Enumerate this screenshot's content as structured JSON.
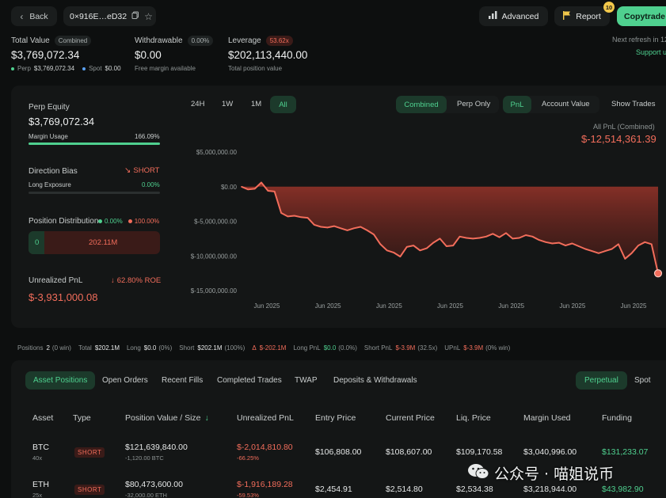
{
  "header": {
    "back_label": "Back",
    "address": "0×916E…eD32",
    "advanced_label": "Advanced",
    "report_label": "Report",
    "report_badge": "10",
    "copytrade_label": "Copytrade"
  },
  "summary": {
    "total_value_label": "Total Value",
    "total_value_tag": "Combined",
    "total_value": "$3,769,072.34",
    "perp_label": "Perp",
    "perp_value": "$3,769,072.34",
    "spot_label": "Spot",
    "spot_value": "$0.00",
    "withdrawable_label": "Withdrawable",
    "withdrawable_tag": "0.00%",
    "withdrawable_value": "$0.00",
    "withdrawable_sub": "Free margin available",
    "leverage_label": "Leverage",
    "leverage_tag": "53.62x",
    "leverage_value": "$202,113,440.00",
    "leverage_sub": "Total position value",
    "refresh_text": "Next refresh in 12",
    "support_label": "Support u"
  },
  "left_panel": {
    "perp_equity_label": "Perp Equity",
    "perp_equity_value": "$3,769,072.34",
    "margin_usage_label": "Margin Usage",
    "margin_usage_value": "166.09%",
    "margin_usage_fill": 1.0,
    "direction_label": "Direction Bias",
    "direction_value": "SHORT",
    "long_exposure_label": "Long Exposure",
    "long_exposure_value": "0.00%",
    "distribution_label": "Position Distribution",
    "dist_long_pct": "0.00%",
    "dist_short_pct": "100.00%",
    "dist_long_value": "0",
    "dist_short_value": "202.11M",
    "unrealized_label": "Unrealized PnL",
    "unrealized_roe": "62.80% ROE",
    "unrealized_value": "$-3,931,000.08"
  },
  "chart_controls": {
    "ranges": [
      "24H",
      "1W",
      "1M",
      "All"
    ],
    "active_range": "All",
    "modes": [
      "Combined",
      "Perp Only"
    ],
    "views": [
      "PnL",
      "Account Value"
    ],
    "show_trades_label": "Show Trades",
    "pnl_title": "All PnL (Combined)",
    "pnl_value": "$-12,514,361.39"
  },
  "chart_data": {
    "type": "area",
    "title": "All PnL (Combined)",
    "ylim": [
      -15000000,
      5000000
    ],
    "yticks": [
      5000000,
      0,
      -5000000,
      -10000000,
      -15000000
    ],
    "ytick_labels": [
      "$5,000,000.00",
      "$0.00",
      "$-5,000,000.00",
      "$-10,000,000.00",
      "$-15,000,000.00"
    ],
    "xtick_labels": [
      "Jun 2025",
      "Jun 2025",
      "Jun 2025",
      "Jun 2025",
      "Jun 2025",
      "Jun 2025",
      "Jun 2025"
    ],
    "series": [
      {
        "color": "#f26d5b",
        "values": [
          0,
          -400000,
          -300000,
          600000,
          -600000,
          -700000,
          -3800000,
          -4300000,
          -4200000,
          -4400000,
          -4500000,
          -5500000,
          -5800000,
          -5900000,
          -5700000,
          -6000000,
          -6300000,
          -6000000,
          -5800000,
          -6300000,
          -6900000,
          -8300000,
          -9200000,
          -9500000,
          -10100000,
          -8700000,
          -8500000,
          -9200000,
          -8900000,
          -8100000,
          -7500000,
          -8600000,
          -8500000,
          -7200000,
          -7400000,
          -7500000,
          -7400000,
          -7200000,
          -6800000,
          -7300000,
          -6700000,
          -7500000,
          -7400000,
          -7000000,
          -7200000,
          -7700000,
          -8000000,
          -8200000,
          -8100000,
          -8500000,
          -8200000,
          -8600000,
          -9000000,
          -9300000,
          -9600000,
          -9300000,
          -9000000,
          -8300000,
          -10400000,
          -9600000,
          -8500000,
          -8000000,
          -8300000,
          -12514361
        ]
      }
    ]
  },
  "stats_bar": {
    "positions_label": "Positions",
    "positions_value": "2",
    "positions_win": "(0 win)",
    "total_label": "Total",
    "total_value": "$202.1M",
    "long_label": "Long",
    "long_value": "$0.0",
    "long_pct": "(0%)",
    "short_label": "Short",
    "short_value": "$202.1M",
    "short_pct": "(100%)",
    "delta_label": "Δ",
    "delta_value": "$-202.1M",
    "long_pnl_label": "Long PnL",
    "long_pnl_value": "$0.0",
    "long_pnl_pct": "(0.0%)",
    "short_pnl_label": "Short PnL",
    "short_pnl_value": "$-3.9M",
    "short_pnl_pct": "(32.5x)",
    "upnl_label": "UPnL",
    "upnl_value": "$-3.9M",
    "upnl_pct": "(0% win)"
  },
  "tabs": {
    "items": [
      "Asset Positions",
      "Open Orders",
      "Recent Fills",
      "Completed Trades",
      "TWAP",
      "Deposits & Withdrawals"
    ],
    "active": "Asset Positions",
    "market_types": [
      "Perpetual",
      "Spot"
    ]
  },
  "table": {
    "headers": [
      "Asset",
      "Type",
      "Position Value / Size",
      "Unrealized PnL",
      "Entry Price",
      "Current Price",
      "Liq. Price",
      "Margin Used",
      "Funding"
    ],
    "rows": [
      {
        "asset": "BTC",
        "leverage": "40x",
        "type": "SHORT",
        "position_value": "$121,639,840.00",
        "size": "-1,120.00 BTC",
        "upnl": "$-2,014,810.80",
        "upnl_pct": "-66.25%",
        "entry": "$106,808.00",
        "current": "$108,607.00",
        "liq": "$109,170.58",
        "margin": "$3,040,996.00",
        "funding": "$131,233.07"
      },
      {
        "asset": "ETH",
        "leverage": "25x",
        "type": "SHORT",
        "position_value": "$80,473,600.00",
        "size": "-32,000.00 ETH",
        "upnl": "$-1,916,189.28",
        "upnl_pct": "-59.53%",
        "entry": "$2,454.91",
        "current": "$2,514.80",
        "liq": "$2,534.38",
        "margin": "$3,218,944.00",
        "funding": "$43,982.90"
      }
    ]
  },
  "watermark": {
    "text": "公众号 · 喵姐说币",
    "logo": "wechat-icon"
  }
}
